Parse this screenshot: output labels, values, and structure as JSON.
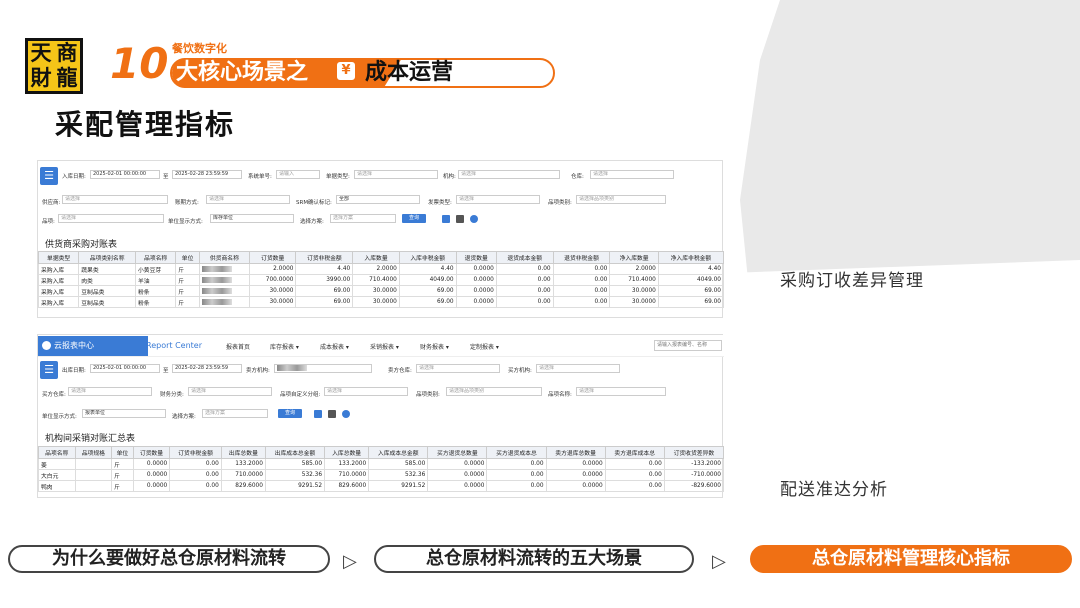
{
  "brand": {
    "logo_chars": [
      "天",
      "商",
      "財",
      "龍"
    ],
    "banner_num": "10",
    "banner_sub": "餐饮数字化",
    "banner_main": "大核心场景之",
    "banner_icon": "¥",
    "banner_right": "成本运营"
  },
  "page_title": "采配管理指标",
  "panel1": {
    "filters": {
      "date_label": "入库日期:",
      "date_from": "2025-02-01 00:00:00",
      "date_to_sep": "至",
      "date_to": "2025-02-28 23:59:59",
      "sys_no_label": "系统单号:",
      "sys_no_ph": "请输入",
      "doc_type_label": "单据类型:",
      "ph": "请选择",
      "org_label": "机构:",
      "wh_label": "仓库:",
      "supplier_label": "供应商:",
      "acct_label": "账期方式:",
      "srm_label": "SRM确认标记:",
      "srm_val": "全部",
      "invoice_label": "发票类型:",
      "cat_label": "品项类别:",
      "cat_ph": "请选择品项类别",
      "item_label": "品项:",
      "unit_label": "单位显示方式:",
      "unit_val": "库存单位",
      "plan_label": "选择方案:",
      "plan_ph": "选择方案",
      "query": "查询"
    },
    "table_title": "供货商采购对账表",
    "headers": [
      "单据类型",
      "品项类别名称",
      "品项名称",
      "单位",
      "供货商名称",
      "订货数量",
      "订货非税金额",
      "入库数量",
      "入库非税金额",
      "退货数量",
      "退货成本金额",
      "退货非税金额",
      "净入库数量",
      "净入库非税金额"
    ],
    "rows": [
      [
        "采购入库",
        "蔬果类",
        "小黄豆芽",
        "斤",
        "",
        "2.0000",
        "4.40",
        "2.0000",
        "4.40",
        "0.0000",
        "0.00",
        "0.00",
        "2.0000",
        "4.40"
      ],
      [
        "采购入库",
        "肉类",
        "羊油",
        "斤",
        "",
        "700.0000",
        "3990.00",
        "710.4000",
        "4049.00",
        "0.0000",
        "0.00",
        "0.00",
        "710.4000",
        "4049.00"
      ],
      [
        "采购入库",
        "豆制品类",
        "粉条",
        "斤",
        "",
        "30.0000",
        "69.00",
        "30.0000",
        "69.00",
        "0.0000",
        "0.00",
        "0.00",
        "30.0000",
        "69.00"
      ],
      [
        "采购入库",
        "豆制品类",
        "粉条",
        "斤",
        "",
        "30.0000",
        "69.00",
        "30.0000",
        "69.00",
        "0.0000",
        "0.00",
        "0.00",
        "30.0000",
        "69.00"
      ]
    ]
  },
  "panel2": {
    "nav": {
      "logo": "云报表中心",
      "sub": "Report Center",
      "items": [
        "报表首页",
        "库存报表 ▾",
        "成本报表 ▾",
        "采销报表 ▾",
        "财务报表 ▾",
        "定制报表 ▾"
      ],
      "search_ph": "请输入报表编号、名称"
    },
    "filters": {
      "date_label": "出库日期:",
      "date_from": "2025-02-01 00:00:00",
      "date_to_sep": "至",
      "date_to": "2025-02-28 23:59:59",
      "seller_org": "卖方机构:",
      "seller_wh": "卖方仓库:",
      "buyer_org": "买方机构:",
      "buyer_wh": "买方仓库:",
      "fin_cat": "财务分类:",
      "custom": "品项自定义分组:",
      "cat": "品项类别:",
      "cat_ph": "请选择品项类别",
      "item": "品项名称:",
      "ph": "请选择",
      "unit_label": "单位显示方式:",
      "unit_val": "报表单位",
      "plan_label": "选择方案:",
      "plan_ph": "选择方案",
      "query": "查询"
    },
    "table_title": "机构间采销对账汇总表",
    "headers": [
      "品项名称",
      "品项规格",
      "单位",
      "订货数量",
      "订货非税金额",
      "出库总数量",
      "出库成本总金额",
      "入库总数量",
      "入库成本总金额",
      "买方退货总数量",
      "买方退货成本总",
      "卖方退库总数量",
      "卖方退库成本总",
      "订货收货差异数"
    ],
    "rows": [
      [
        "姜",
        "",
        "斤",
        "0.0000",
        "0.00",
        "133.2000",
        "585.00",
        "133.2000",
        "585.00",
        "0.0000",
        "0.00",
        "0.0000",
        "0.00",
        "-133.2000"
      ],
      [
        "大白元",
        "",
        "斤",
        "0.0000",
        "0.00",
        "710.0000",
        "532.36",
        "710.0000",
        "532.36",
        "0.0000",
        "0.00",
        "0.0000",
        "0.00",
        "-710.0000"
      ],
      [
        "鸭肉",
        "",
        "斤",
        "0.0000",
        "0.00",
        "829.6000",
        "9291.52",
        "829.6000",
        "9291.52",
        "0.0000",
        "0.00",
        "0.0000",
        "0.00",
        "-829.6000"
      ]
    ]
  },
  "notes": {
    "n1": "采购订收差异管理",
    "n2": "配送准达分析"
  },
  "steps": [
    "为什么要做好总仓原材料流转",
    "总仓原材料流转的五大场景",
    "总仓原材料管理核心指标"
  ],
  "colors": {
    "accent": "#f07014",
    "blue": "#3a7bd5",
    "logo_yellow": "#f5c518"
  }
}
